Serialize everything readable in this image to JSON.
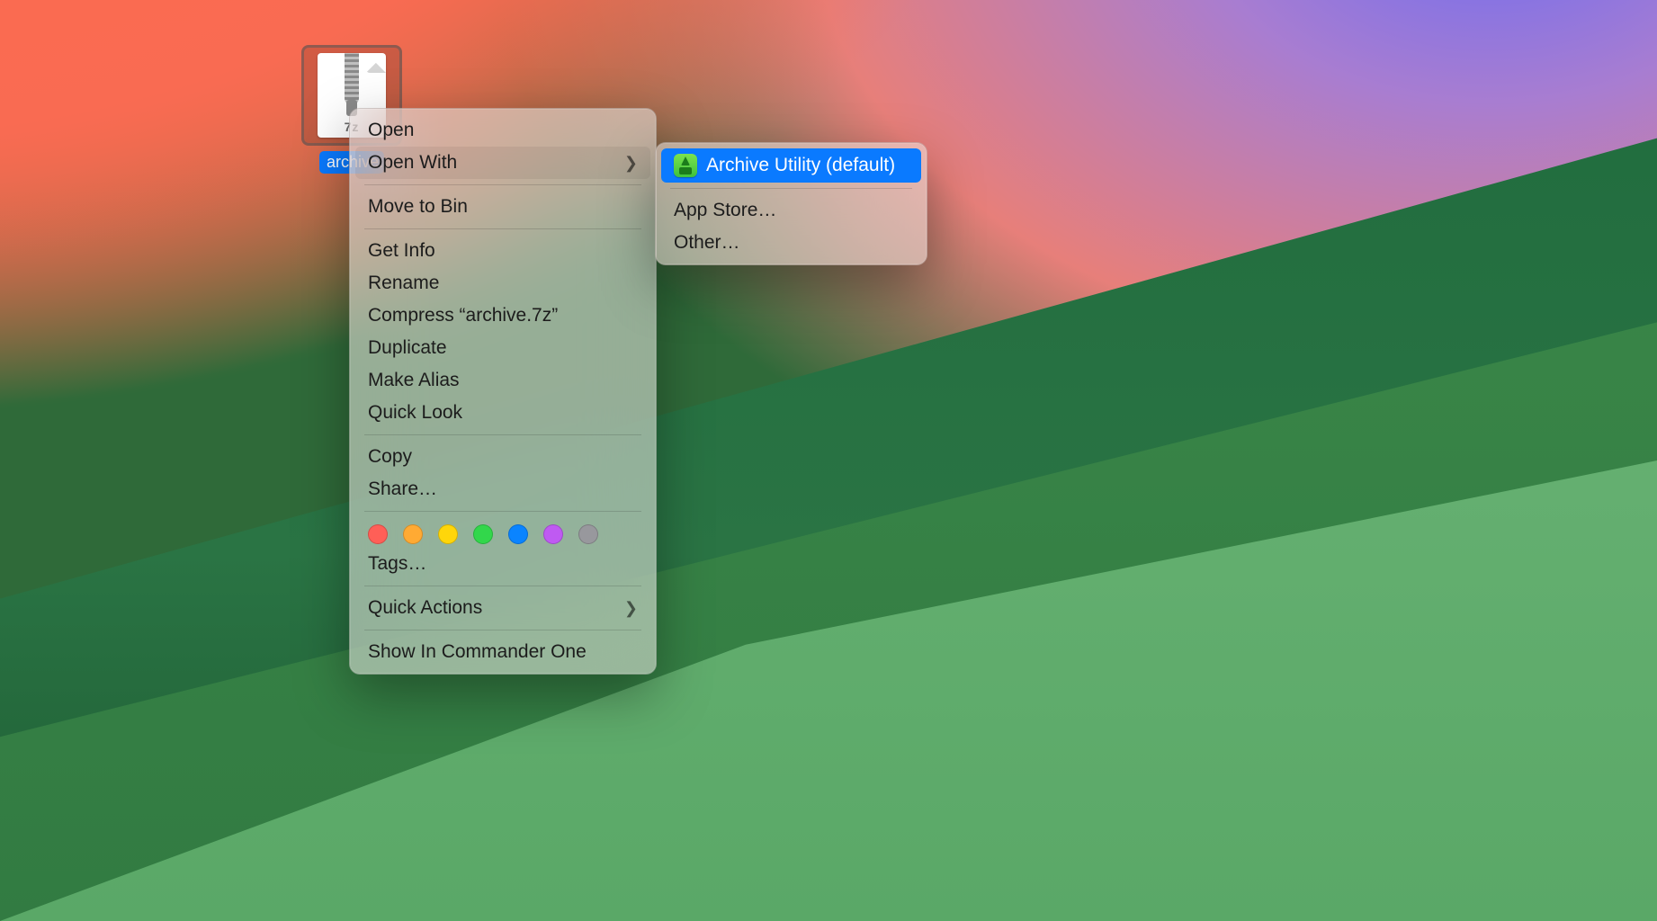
{
  "file": {
    "name": "archive.7z",
    "icon_ext": "7z"
  },
  "context_menu": {
    "open": "Open",
    "open_with": "Open With",
    "move_to_bin": "Move to Bin",
    "get_info": "Get Info",
    "rename": "Rename",
    "compress": "Compress “archive.7z”",
    "duplicate": "Duplicate",
    "make_alias": "Make Alias",
    "quick_look": "Quick Look",
    "copy": "Copy",
    "share": "Share…",
    "tags": "Tags…",
    "quick_actions": "Quick Actions",
    "show_in_commander_one": "Show In Commander One"
  },
  "open_with_submenu": {
    "archive_utility": "Archive Utility (default)",
    "app_store": "App Store…",
    "other": "Other…"
  },
  "tag_colors": [
    "#ff5f57",
    "#ffaa33",
    "#ffd60a",
    "#32d74b",
    "#0a84ff",
    "#bf5af2",
    "#98989d"
  ]
}
